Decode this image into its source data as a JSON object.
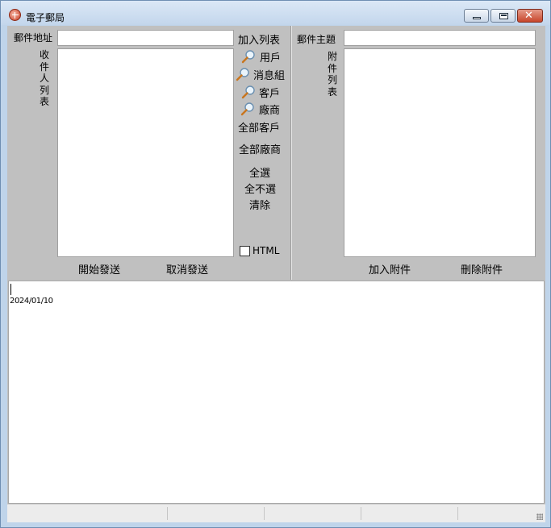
{
  "window": {
    "title": "電子郵局"
  },
  "form": {
    "email_address_label": "郵件地址",
    "recipient_list_label": "收件人列表",
    "email_subject_label": "郵件主題",
    "attachment_list_label": "附件列表",
    "email_address_value": "",
    "email_subject_value": ""
  },
  "add_list": {
    "header": "加入列表",
    "items": [
      {
        "label": "用戶",
        "icon": "search-icon"
      },
      {
        "label": "消息組",
        "icon": "search-icon"
      },
      {
        "label": "客戶",
        "icon": "search-icon"
      },
      {
        "label": "廠商",
        "icon": "search-icon"
      }
    ],
    "all_customers": "全部客戶",
    "all_vendors": "全部廠商",
    "select_all": "全選",
    "select_none": "全不選",
    "clear": "清除",
    "html_label": "HTML",
    "html_checked": false
  },
  "buttons": {
    "start_send": "開始發送",
    "cancel_send": "取消發送",
    "add_attachment": "加入附件",
    "delete_attachment": "刪除附件"
  },
  "editor": {
    "date_text": "2024/01/10"
  },
  "colors": {
    "client_bg": "#c0c0c0",
    "titlebar": "#c3d6ec",
    "close_button": "#c8462b"
  }
}
